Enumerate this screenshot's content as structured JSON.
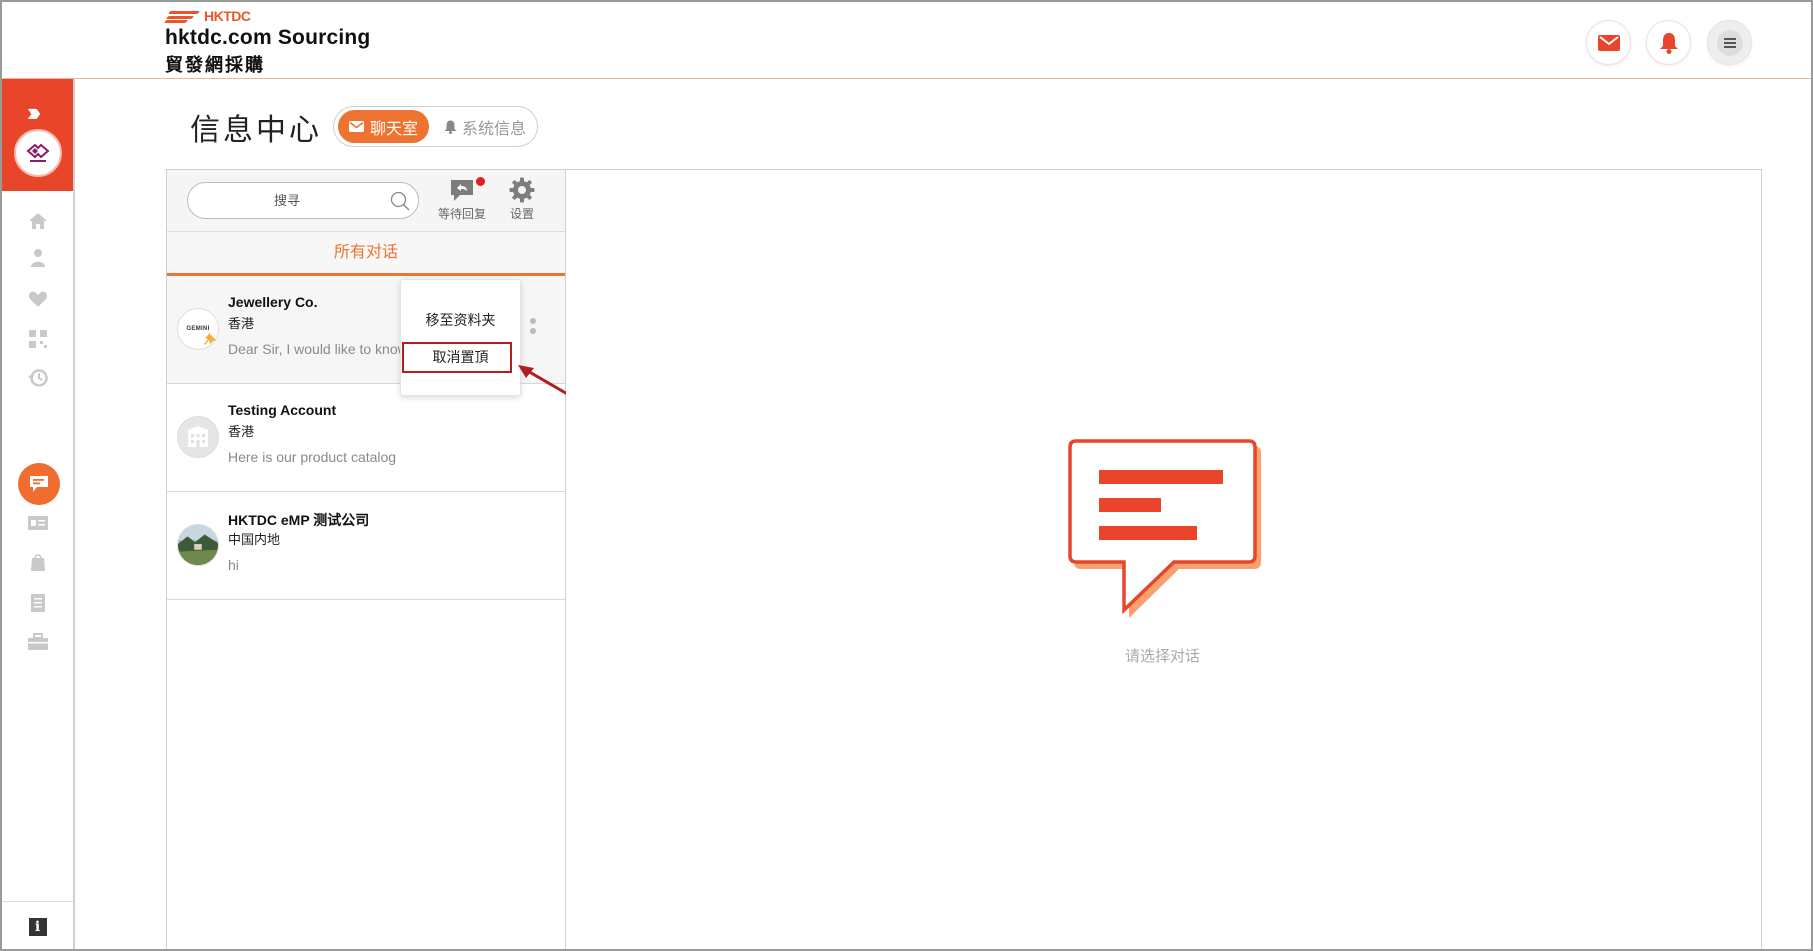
{
  "header": {
    "brand": "HKTDC",
    "title": "hktdc.com Sourcing",
    "subtitle": "貿發網採購",
    "mail_icon": "mail-icon",
    "bell_icon": "bell-icon",
    "menu_icon": "hamburger-menu-icon"
  },
  "sidebar": {
    "items": [
      "home-icon",
      "user-icon",
      "heart-icon",
      "qr-icon",
      "history-icon",
      "chat-icon",
      "card-icon",
      "bag-icon",
      "document-icon",
      "briefcase-icon"
    ],
    "active": "chat-icon",
    "info_label": "i"
  },
  "page": {
    "title": "信息中心",
    "tabs": [
      {
        "label": "聊天室",
        "active": true
      },
      {
        "label": "系统信息",
        "active": false
      }
    ]
  },
  "chatlist": {
    "search_placeholder": "搜寻",
    "tools": [
      {
        "label": "等待回复",
        "icon": "reply-bubble-icon",
        "has_dot": true
      },
      {
        "label": "设置",
        "icon": "gear-icon",
        "has_dot": false
      }
    ],
    "filter_label": "所有对话",
    "conversations": [
      {
        "name": "Jewellery Co.",
        "region": "香港",
        "message": "Dear Sir, I would like to know",
        "avatar_text": "GEMINI",
        "pinned": true
      },
      {
        "name": "Testing Account",
        "region": "香港",
        "message": "Here is our product catalog",
        "pinned": false
      },
      {
        "name": "HKTDC eMP 测试公司",
        "region": "中国内地",
        "message": "hi",
        "pinned": false
      }
    ]
  },
  "context_menu": {
    "items": [
      "移至资料夹",
      "取消置頂"
    ],
    "highlighted": "取消置頂"
  },
  "main": {
    "empty_text": "请选择对话"
  },
  "colors": {
    "accent": "#ef7330",
    "brand_red": "#e8452b",
    "highlight_border": "#b31d1d"
  }
}
